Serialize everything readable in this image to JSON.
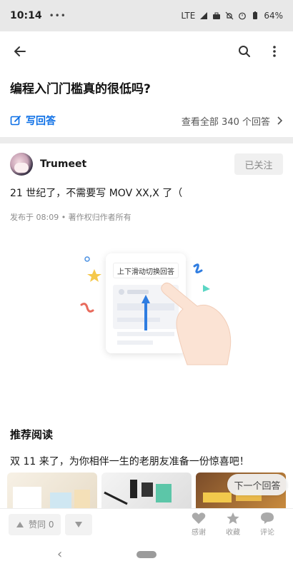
{
  "status_bar": {
    "time": "10:14",
    "dots": "•••",
    "network": "LTE",
    "battery": "64%"
  },
  "top_bar": {
    "back_icon": "arrow-left-icon",
    "search_icon": "search-icon",
    "more_icon": "more-vertical-icon"
  },
  "question": {
    "title": "编程入门门槛真的很低吗?",
    "write_answer": "写回答",
    "view_all": "查看全部 340 个回答"
  },
  "answer": {
    "author": "Trumeet",
    "follow_label": "已关注",
    "text": "21 世纪了，不需要写 MOV XX,X 了（",
    "meta": "发布于 08:09 • 著作权归作者所有"
  },
  "illustration": {
    "card_title": "上下滑动切换回答"
  },
  "recommended": {
    "title": "推荐阅读",
    "item_title": "双 11 来了，为你相伴一生的老朋友准备一份惊喜吧！",
    "next_answer": "下一个回答"
  },
  "action_bar": {
    "vote_up": "赞同 0",
    "thanks": "感谢",
    "favorite": "收藏",
    "comment": "评论"
  },
  "colors": {
    "accent": "#0a6ee6",
    "status_bar_bg": "#e8e8e8",
    "divider": "#ececec"
  }
}
